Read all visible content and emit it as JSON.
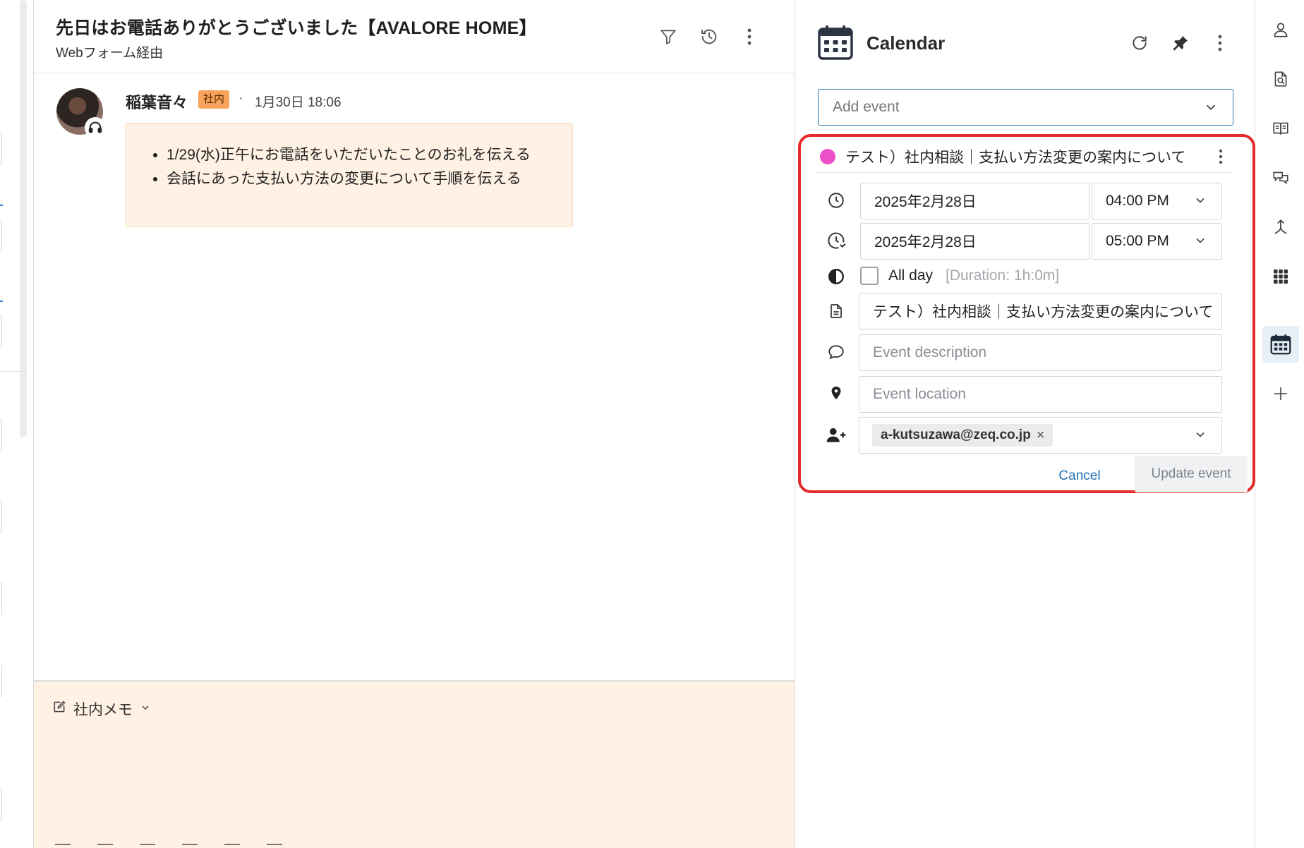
{
  "conversation": {
    "subject": "先日はお電話ありがとうございました【AVALORE HOME】",
    "source": "Webフォーム経由",
    "message": {
      "author": "稲葉音々",
      "tag": "社内",
      "separator": "·",
      "time": "1月30日 18:06",
      "bullets": [
        "1/29(水)正午にお電話をいただいたことのお礼を伝える",
        "会話にあった支払い方法の変更について手順を伝える"
      ]
    },
    "compose": {
      "mode_label": "社内メモ"
    }
  },
  "calendar": {
    "title": "Calendar",
    "add_event_placeholder": "Add event",
    "event": {
      "title": "テスト）社内相談｜支払い方法変更の案内について",
      "color": "#ec4fc8",
      "start_date": "2025年2月28日",
      "start_time": "04:00 PM",
      "end_date": "2025年2月28日",
      "end_time": "05:00 PM",
      "all_day_label": "All day",
      "all_day_checked": false,
      "duration": "[Duration: 1h:0m]",
      "name_value": "テスト）社内相談｜支払い方法変更の案内について",
      "description_placeholder": "Event description",
      "location_placeholder": "Event location",
      "attendees": [
        "a-kutsuzawa@zeq.co.jp"
      ],
      "cancel_label": "Cancel",
      "update_label": "Update event"
    }
  },
  "colors": {
    "highlight_border": "#e32b2b",
    "accent": "#1f6fb5",
    "memo_background": "#fff1e3",
    "tag_background": "#f7a35c"
  }
}
